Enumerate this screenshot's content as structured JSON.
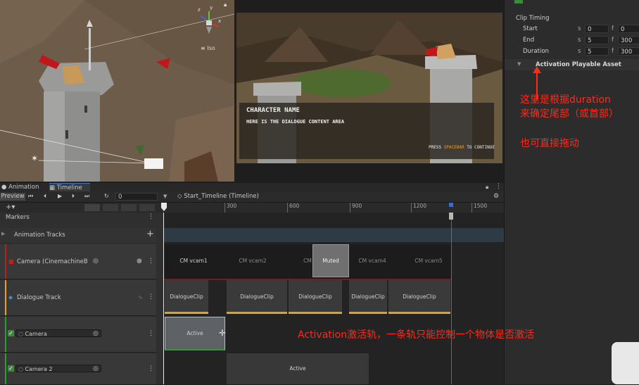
{
  "scene": {
    "iso_label": "Iso",
    "axis_x": "x",
    "axis_y": "y",
    "axis_z": "z"
  },
  "game_view": {
    "character_name": "CHARACTER NAME",
    "dialogue_text": "HERE IS THE DIALOGUE CONTENT AREA",
    "continue_prefix": "PRESS",
    "continue_key": "SPACEBAR",
    "continue_suffix": "TO CONTINUE"
  },
  "inspector": {
    "section_title": "Clip Timing",
    "rows": [
      {
        "label": "Start",
        "s_label": "s",
        "s_value": "0",
        "f_label": "f",
        "f_value": "0"
      },
      {
        "label": "End",
        "s_label": "s",
        "s_value": "5",
        "f_label": "f",
        "f_value": "300"
      },
      {
        "label": "Duration",
        "s_label": "s",
        "s_value": "5",
        "f_label": "f",
        "f_value": "300"
      }
    ],
    "asset_label": "Activation Playable Asset",
    "note_line1": "这里是根据duration",
    "note_line2": "来确定尾部（或首部）",
    "note_line3": "也可直接拖动"
  },
  "tabs": {
    "animation": "Animation",
    "timeline": "Timeline"
  },
  "toolbar": {
    "preview": "Preview",
    "frame_value": "0",
    "asset_name": "Start_Timeline (Timeline)"
  },
  "ruler": {
    "ticks": [
      "300",
      "600",
      "900",
      "1200",
      "1500"
    ]
  },
  "headers": {
    "markers": "Markers",
    "animation_tracks": "Animation Tracks",
    "add_symbol": "+",
    "tracks": [
      {
        "label": "Camera (CinemachineB",
        "color": "#a8282a"
      },
      {
        "label": "Dialogue Track",
        "color": "#e2a21c"
      },
      {
        "label": "Camera",
        "color": "#2f9a32"
      },
      {
        "label": "Camera 2",
        "color": "#2f9a32"
      }
    ]
  },
  "clips": {
    "cinemachine": [
      "CM vcam1",
      "CM vcam2",
      "CM",
      "Muted",
      "CM vcam4",
      "CM vcam5"
    ],
    "dialogue": [
      "DialogueClip",
      "DialogueClip",
      "DialogueClip",
      "DialogueClip",
      "DialogueClip"
    ],
    "camera": "Active",
    "camera2": "Active"
  },
  "annotation": "Activation激活轨，一条轨只能控制一个物体是否激活",
  "colors": {
    "note_red": "#ff2a1a",
    "playhead_blue": "#3b6bd6",
    "dialogue_underline": "#e2a21c",
    "activation_green": "#2f9a32"
  }
}
